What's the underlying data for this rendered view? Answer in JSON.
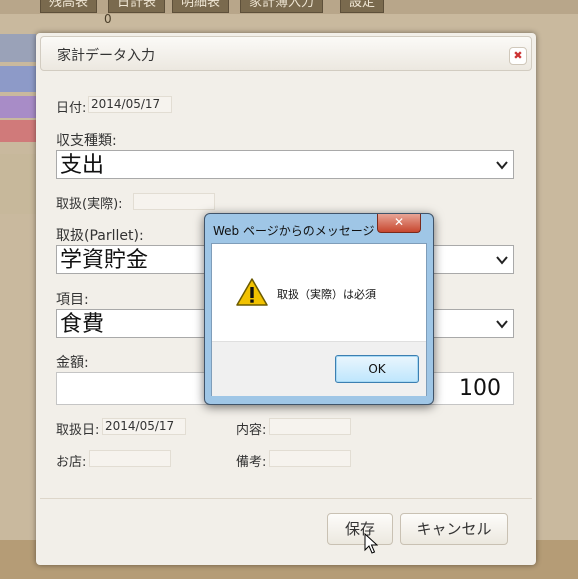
{
  "background": {
    "tabs": [
      "残高表",
      "日計表",
      "明細表",
      "家計簿入力",
      "設定"
    ],
    "value": "0"
  },
  "dialog": {
    "title": "家計データ入力",
    "date_label": "日付:",
    "date_value": "2014/05/17",
    "category_label": "収支種類:",
    "category_value": "支出",
    "actual_label": "取扱(実際):",
    "actual_value": "",
    "parlet_label": "取扱(Parllet):",
    "parlet_value": "学資貯金",
    "item_label": "項目:",
    "item_value": "食費",
    "amount_label": "金額:",
    "amount_value": "100",
    "handle_date_label": "取扱日:",
    "handle_date_value": "2014/05/17",
    "content_label": "内容:",
    "content_value": "",
    "shop_label": "お店:",
    "shop_value": "",
    "note_label": "備考:",
    "note_value": "",
    "save_label": "保存",
    "cancel_label": "キャンセル"
  },
  "message_box": {
    "title": "Web ページからのメッセージ",
    "text": "取扱（実際）は必須",
    "ok_label": "OK",
    "icon": "warning-icon"
  },
  "colors": {
    "warning": "#f2c200",
    "dialog_bg": "#f2efe9",
    "page_bg": "#c9b99e"
  }
}
